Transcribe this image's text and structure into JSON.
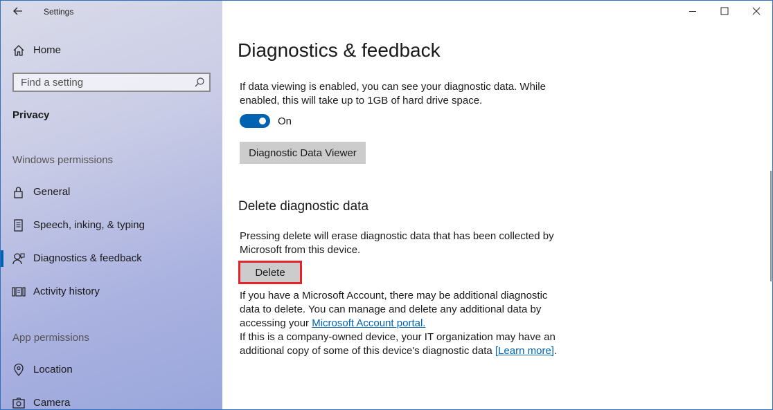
{
  "window": {
    "app_title": "Settings"
  },
  "sidebar": {
    "home_label": "Home",
    "search_placeholder": "Find a setting",
    "section_privacy": "Privacy",
    "group_windows_permissions": "Windows permissions",
    "items": [
      {
        "label": "General",
        "icon": "lock-icon"
      },
      {
        "label": "Speech, inking, & typing",
        "icon": "speech-icon"
      },
      {
        "label": "Diagnostics & feedback",
        "icon": "feedback-icon",
        "active": true
      },
      {
        "label": "Activity history",
        "icon": "activity-icon"
      }
    ],
    "group_app_permissions": "App permissions",
    "app_items": [
      {
        "label": "Location",
        "icon": "location-icon"
      },
      {
        "label": "Camera",
        "icon": "camera-icon"
      }
    ]
  },
  "main": {
    "page_title": "Diagnostics & feedback",
    "viewing_description": "If data viewing is enabled, you can see your diagnostic data. While enabled, this will take up to 1GB of hard drive space.",
    "toggle_state": "On",
    "viewer_button": "Diagnostic Data Viewer",
    "delete_heading": "Delete diagnostic data",
    "delete_description": "Pressing delete will erase diagnostic data that has been collected by Microsoft from this device.",
    "delete_button": "Delete",
    "account_text": "If you have a Microsoft Account, there may be additional diagnostic data to delete. You can manage and delete any additional data by accessing your ",
    "account_link": "Microsoft Account portal.",
    "company_text": "If this is a company-owned device, your IT organization may have an additional copy of some of this device's diagnostic data ",
    "learn_more_link": "[Learn more]",
    "learn_more_suffix": "."
  },
  "colors": {
    "accent": "#0063b1",
    "highlight": "#e3242b",
    "button_bg": "#cccccc"
  }
}
